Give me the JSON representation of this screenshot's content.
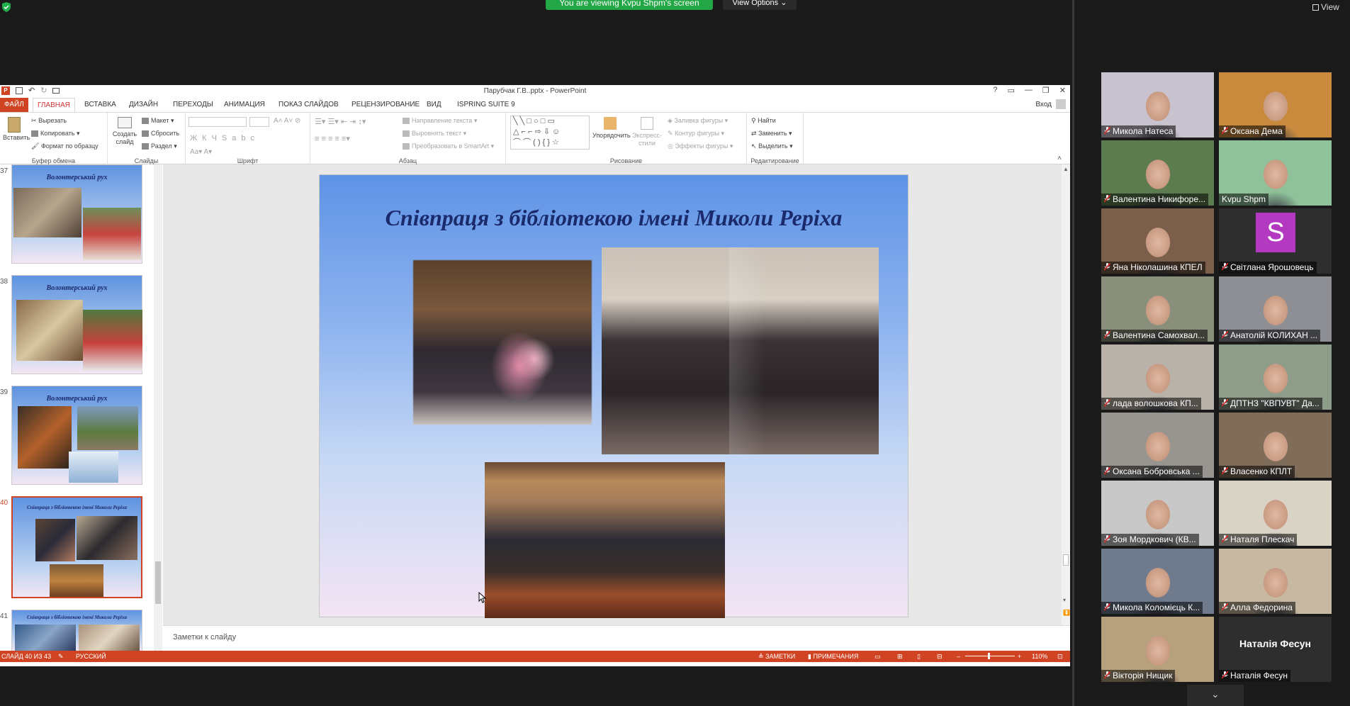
{
  "zoom": {
    "share_banner": "You are viewing Kvpu Shpm's screen",
    "view_options": "View Options",
    "view_button": "View"
  },
  "ppt": {
    "title": "Парубчак Г.В..pptx - PowerPoint",
    "signin": "Вход",
    "tabs": [
      "ФАЙЛ",
      "ГЛАВНАЯ",
      "ВСТАВКА",
      "ДИЗАЙН",
      "ПЕРЕХОДЫ",
      "АНИМАЦИЯ",
      "ПОКАЗ СЛАЙДОВ",
      "РЕЦЕНЗИРОВАНИЕ",
      "ВИД",
      "ISPRING SUITE 9"
    ],
    "active_tab": "ГЛАВНАЯ",
    "ribbon": {
      "clipboard": {
        "label": "Буфер обмена",
        "paste": "Вставить",
        "cut": "Вырезать",
        "copy": "Копировать",
        "format": "Формат по образцу"
      },
      "slides": {
        "label": "Слайды",
        "new_slide": "Создать слайд",
        "layout": "Макет",
        "reset": "Сбросить",
        "section": "Раздел"
      },
      "font": {
        "label": "Шрифт"
      },
      "paragraph": {
        "label": "Абзац",
        "direction": "Направление текста",
        "align": "Выровнять текст",
        "smartart": "Преобразовать в SmartArt"
      },
      "drawing": {
        "label": "Рисование",
        "arrange": "Упорядочить",
        "quick_styles": "Экспресс-стили",
        "fill": "Заливка фигуры",
        "outline": "Контур фигуры",
        "effects": "Эффекты фигуры"
      },
      "editing": {
        "label": "Редактирование",
        "find": "Найти",
        "replace": "Заменить",
        "select": "Выделить"
      }
    },
    "thumbnails": [
      {
        "num": "37",
        "title": "Волонтерський рух"
      },
      {
        "num": "38",
        "title": "Волонтерський рух"
      },
      {
        "num": "39",
        "title": "Волонтерський рух"
      },
      {
        "num": "40",
        "title": "Співпраця з бібліотекою імені Миколи Реріха"
      },
      {
        "num": "41",
        "title": "Співпраця з бібліотекою імені Миколи Реріха"
      }
    ],
    "slide": {
      "title": "Співпраця з бібліотекою імені Миколи Реріха"
    },
    "notes_placeholder": "Заметки к слайду",
    "status": {
      "slide": "СЛАЙД 40 ИЗ 43",
      "language": "РУССКИЙ",
      "notes": "ЗАМЕТКИ",
      "comments": "ПРИМЕЧАНИЯ",
      "zoom": "110%"
    }
  },
  "participants": [
    {
      "name": "Микола Натеса",
      "muted": true,
      "bg": "#c9c3cf"
    },
    {
      "name": "Оксана Дема",
      "muted": true,
      "bg": "#c98a3e"
    },
    {
      "name": "Валентина Никифоре...",
      "muted": true,
      "bg": "#5c7b4f"
    },
    {
      "name": "Kvpu Shpm",
      "muted": false,
      "bg": "#8fc29a",
      "speaking": true
    },
    {
      "name": "Яна Ніколашина КПЕЛ",
      "muted": true,
      "bg": "#7b5f4a"
    },
    {
      "name": "Світлана Ярошовець",
      "muted": true,
      "avatar": "S",
      "avatar_color": "#b33ac0"
    },
    {
      "name": "Валентина Самохвал...",
      "muted": true,
      "bg": "#8a8f7c"
    },
    {
      "name": "Анатолій КОЛИХАН ...",
      "muted": true,
      "bg": "#8d8f94"
    },
    {
      "name": "лада волошкова КП...",
      "muted": true,
      "bg": "#b9b2a9"
    },
    {
      "name": "ДПТНЗ \"КВПУВТ\" Да...",
      "muted": true,
      "bg": "#8e9c8a"
    },
    {
      "name": "Оксана Бобровська ...",
      "muted": true,
      "bg": "#989590"
    },
    {
      "name": "Власенко КПЛТ",
      "muted": true,
      "bg": "#7f6d5a"
    },
    {
      "name": "Зоя Мордкович (КВ...",
      "muted": true,
      "bg": "#c8c8c8"
    },
    {
      "name": "Наталя Плескач",
      "muted": true,
      "bg": "#d9d3c6"
    },
    {
      "name": "Микола Коломієць К...",
      "muted": true,
      "bg": "#6f7a8c"
    },
    {
      "name": "Алла Федорина",
      "muted": true,
      "bg": "#c7b8a1"
    },
    {
      "name": "Вікторія Нищик",
      "muted": true,
      "bg": "#b7a07c"
    },
    {
      "name": "Наталія Фесун",
      "muted": true,
      "avatar_text": "Наталія Фесун"
    }
  ]
}
